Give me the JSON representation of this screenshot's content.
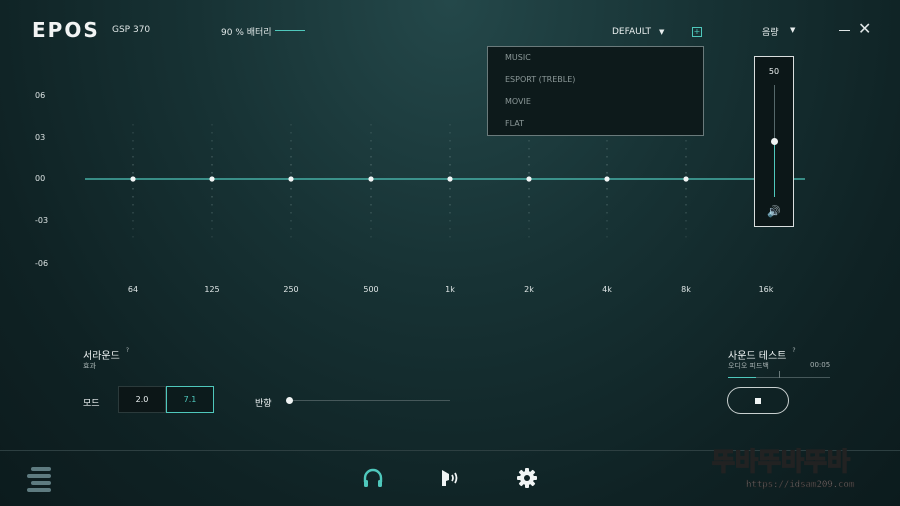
{
  "header": {
    "logo": "EPOS",
    "model": "GSP 370",
    "battery": "90 % 배터리",
    "preset": "DEFAULT",
    "preset_caret": "▼",
    "add_preset": "+",
    "volume_menu": "음량",
    "volume_caret": "▼",
    "close": "✕"
  },
  "preset_dropdown": {
    "items": [
      {
        "label": "MUSIC",
        "active": true
      },
      {
        "label": "ESPORT (TREBLE)",
        "active": false
      },
      {
        "label": "MOVIE",
        "active": false
      },
      {
        "label": "FLAT",
        "active": false
      }
    ]
  },
  "volume_popup": {
    "value": "50",
    "level": 0.5,
    "speaker_icon": "🔊"
  },
  "eq": {
    "y_labels": [
      "06",
      "03",
      "00",
      "-03",
      "-06"
    ],
    "bands": [
      "64",
      "125",
      "250",
      "500",
      "1k",
      "2k",
      "4k",
      "8k",
      "16k"
    ],
    "gains": [
      0,
      0,
      0,
      0,
      0,
      0,
      0,
      0,
      0
    ],
    "accent": "#4fc8bc"
  },
  "surround": {
    "title": "서라운드",
    "help": "?",
    "subtitle": "효과",
    "mode_label": "모드",
    "modes": [
      {
        "label": "2.0",
        "selected": false
      },
      {
        "label": "7.1",
        "selected": true
      }
    ],
    "reverb_label": "반향",
    "reverb_level": 0
  },
  "sound_test": {
    "title": "사운드 테스트",
    "help": "?",
    "subtitle": "오디오 피드백",
    "time": "00:05",
    "progress": 0.27
  },
  "bottom_nav": {
    "icons": [
      "menu-icon",
      "headphones-icon",
      "sidetone-icon",
      "settings-icon"
    ]
  },
  "watermark": {
    "text": "뚜바뚜바뚜바",
    "url": "https://idsam209.com"
  }
}
